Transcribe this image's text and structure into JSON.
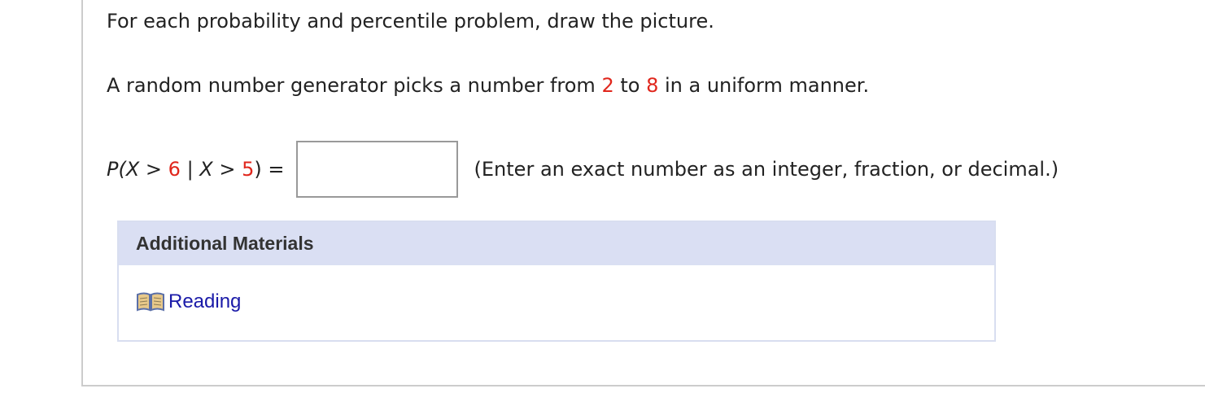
{
  "instructions": "For each probability and percentile problem, draw the picture.",
  "problem": {
    "text_before": "A random number generator picks a number from ",
    "low": "2",
    "text_mid": " to ",
    "high": "8",
    "text_after": " in a uniform manner."
  },
  "equation": {
    "p_open": "P(",
    "x1": "X",
    "gt1": " > ",
    "val1": "6",
    "bar": " | ",
    "x2": "X",
    "gt2": " > ",
    "val2": "5",
    "p_close": ")",
    "equals": " ="
  },
  "answer": {
    "value": "",
    "placeholder": ""
  },
  "hint": "(Enter an exact number as an integer, fraction, or decimal.)",
  "materials": {
    "title": "Additional Materials",
    "link_label": "Reading",
    "link_icon": "book-icon"
  },
  "colors": {
    "highlight_red": "#e0261c",
    "link_blue": "#1a1aa8",
    "materials_header_bg": "#dadff3"
  }
}
